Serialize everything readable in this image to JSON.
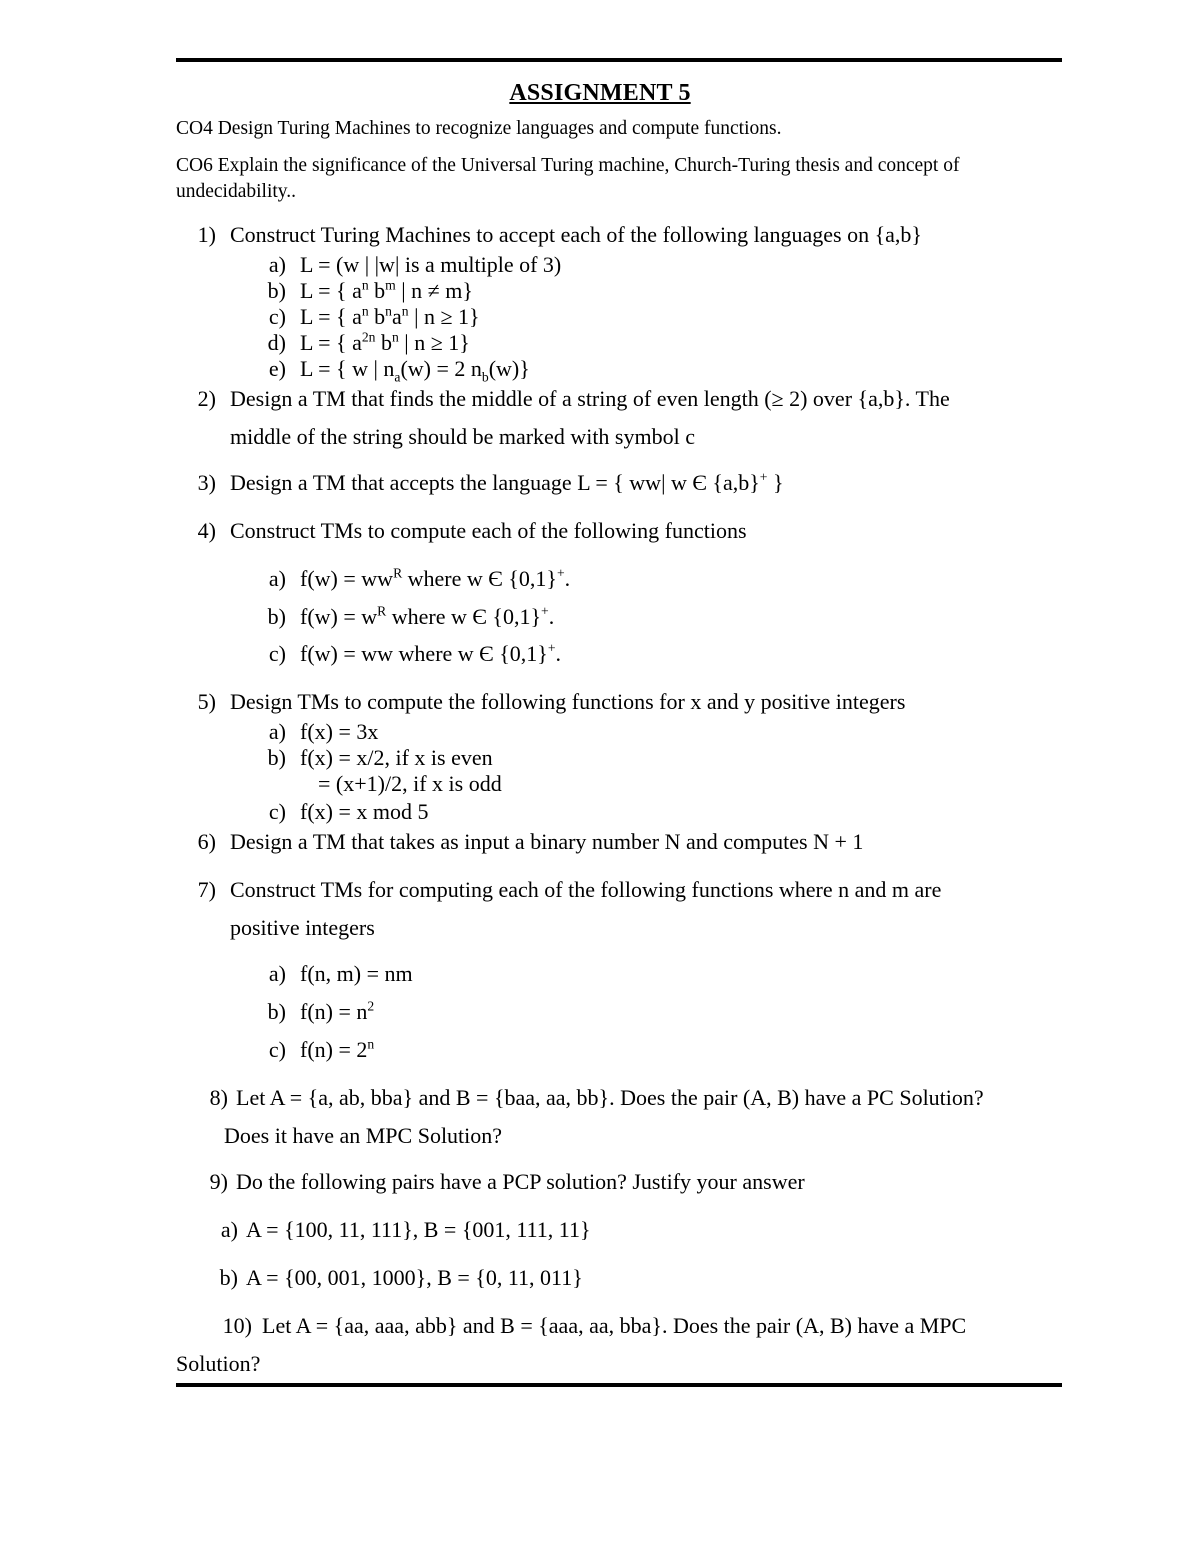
{
  "document": {
    "title": "ASSIGNMENT 5",
    "course_outcomes": [
      "CO4 Design Turing Machines to recognize languages and compute functions.",
      "CO6 Explain the significance of the Universal Turing machine, Church-Turing thesis and concept of undecidability.."
    ]
  },
  "questions": {
    "q1": {
      "marker": "1)",
      "text": "Construct Turing Machines to accept each of the following languages on {a,b}",
      "a_marker": "a)",
      "a_text": "L = (w | |w| is a multiple of 3)",
      "b_marker": "b)",
      "b_prefix": "L = { a",
      "b_sup1": "n",
      "b_mid": " b",
      "b_sup2": "m",
      "b_suffix": " |  n ≠ m}",
      "c_marker": "c)",
      "c_prefix": "L = { a",
      "c_sup1": "n",
      "c_mid": " b",
      "c_sup2": "n",
      "c_mid2": "a",
      "c_sup3": "n",
      "c_suffix": " | n ≥ 1}",
      "d_marker": "d)",
      "d_prefix": "L = { a",
      "d_sup1": "2n",
      "d_mid": " b",
      "d_sup2": "n",
      "d_suffix": " |  n ≥ 1}",
      "e_marker": "e)",
      "e_prefix": "L = { w | n",
      "e_sub1": "a",
      "e_mid": "(w) = 2 n",
      "e_sub2": "b",
      "e_suffix": "(w)}"
    },
    "q2": {
      "marker": "2)",
      "line1": "Design a TM that finds the middle of a string of even length (≥ 2) over {a,b}. The",
      "line2": "middle of the string should be marked with symbol c"
    },
    "q3": {
      "marker": "3)",
      "prefix": "Design a TM that accepts the language L = { ww| w Є {a,b}",
      "sup": "+",
      "suffix": " }"
    },
    "q4": {
      "marker": "4)",
      "text": "Construct TMs to compute each of the following functions",
      "a_marker": "a)",
      "a_prefix": "f(w) = ww",
      "a_supR": "R",
      "a_mid": " where w Є {0,1}",
      "a_sup": "+",
      "a_suffix": ".",
      "b_marker": "b)",
      "b_prefix": "f(w) = w",
      "b_supR": "R",
      "b_mid": " where w Є {0,1}",
      "b_sup": "+",
      "b_suffix": ".",
      "c_marker": "c)",
      "c_prefix": "f(w) = ww where w Є {0,1}",
      "c_sup": "+",
      "c_suffix": "."
    },
    "q5": {
      "marker": "5)",
      "text": "Design TMs to compute the following functions for x and y positive integers",
      "a_marker": "a)",
      "a_text": "f(x) = 3x",
      "b_marker": "b)",
      "b_text": "f(x) = x/2, if x is even",
      "b_cont": "= (x+1)/2, if x is odd",
      "c_marker": "c)",
      "c_text": "f(x) = x mod 5"
    },
    "q6": {
      "marker": "6)",
      "text": "Design a TM that takes as input a binary number N and computes N + 1"
    },
    "q7": {
      "marker": "7)",
      "line1": "Construct TMs for computing each of the following functions where n and m are",
      "line2": "positive integers",
      "a_marker": "a)",
      "a_text": "f(n, m) = nm",
      "b_marker": "b)",
      "b_prefix": "f(n) = n",
      "b_sup": "2",
      "c_marker": "c)",
      "c_prefix": "f(n) = 2",
      "c_sup": "n"
    },
    "q8": {
      "marker": "8)",
      "line1": "Let A = {a, ab, bba} and B = {baa, aa, bb}. Does the pair (A, B) have a PC Solution?",
      "line2": "Does it have an MPC Solution?"
    },
    "q9": {
      "marker": "9)",
      "text": "Do the following pairs have a PCP solution? Justify your answer",
      "a_marker": "a)",
      "a_text": "A = {100, 11, 111}, B = {001, 111, 11}",
      "b_marker": "b)",
      "b_text": "A = {00, 001, 1000}, B = {0, 11, 011}"
    },
    "q10": {
      "marker": "10)",
      "line1": "Let A = {aa, aaa, abb} and B = {aaa, aa, bba}. Does the pair (A, B) have a MPC",
      "line2": "Solution?"
    }
  }
}
